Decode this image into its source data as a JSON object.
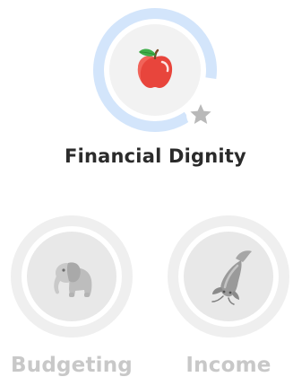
{
  "skills": [
    {
      "label": "Financial Dignity",
      "icon": "apple-icon",
      "status": "active",
      "progress": 0.87,
      "ring_color": "#d3e5fb",
      "inner_color": "#f2f2f2",
      "label_color": "#2b2b2b",
      "badge": "star-icon"
    },
    {
      "label": "Budgeting",
      "icon": "elephant-icon",
      "status": "locked",
      "ring_color": "#efefef",
      "inner_color": "#e8e8e8",
      "label_color": "#c8c8c8"
    },
    {
      "label": "Income",
      "icon": "koi-fish-icon",
      "status": "locked",
      "ring_color": "#efefef",
      "inner_color": "#e8e8e8",
      "label_color": "#c8c8c8"
    }
  ]
}
